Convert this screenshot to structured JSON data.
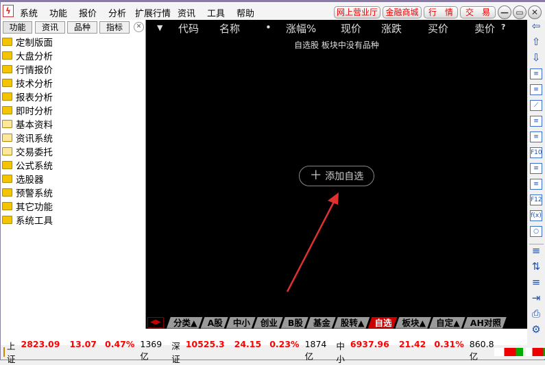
{
  "menu": {
    "items": [
      "系统",
      "功能",
      "报价",
      "分析",
      "扩展行情",
      "资讯",
      "工具",
      "帮助"
    ],
    "red_buttons": [
      "网上营业厅",
      "金融商城",
      "行　情",
      "交　易"
    ]
  },
  "left": {
    "tabs": [
      "功能",
      "资讯",
      "品种",
      "指标"
    ],
    "items": [
      {
        "label": "定制版面",
        "open": false
      },
      {
        "label": "大盘分析",
        "open": false
      },
      {
        "label": "行情报价",
        "open": false
      },
      {
        "label": "技术分析",
        "open": false
      },
      {
        "label": "报表分析",
        "open": false
      },
      {
        "label": "即时分析",
        "open": false
      },
      {
        "label": "基本资料",
        "open": true
      },
      {
        "label": "资讯系统",
        "open": true
      },
      {
        "label": "交易委托",
        "open": true
      },
      {
        "label": "公式系统",
        "open": false
      },
      {
        "label": "选股器",
        "open": false
      },
      {
        "label": "预警系统",
        "open": false
      },
      {
        "label": "其它功能",
        "open": false
      },
      {
        "label": "系统工具",
        "open": false
      }
    ]
  },
  "main": {
    "columns": [
      "代码",
      "名称",
      "•",
      "涨幅%",
      "现价",
      "涨跌",
      "买价",
      "卖价"
    ],
    "help": "?",
    "empty_message": "自选股 板块中没有品种",
    "add_button": "添加自选",
    "annotation_arrow_color": "#e03030"
  },
  "tabs": [
    {
      "label": "分类▲"
    },
    {
      "label": "A股"
    },
    {
      "label": "中小"
    },
    {
      "label": "创业"
    },
    {
      "label": "B股"
    },
    {
      "label": "基金"
    },
    {
      "label": "股转▲"
    },
    {
      "label": "自选",
      "active": true
    },
    {
      "label": "板块▲"
    },
    {
      "label": "自定▲"
    },
    {
      "label": "AH对照"
    }
  ],
  "toolbar_icons": [
    "arrow-left-icon",
    "arrow-up-icon",
    "arrow-down-icon",
    "quote-list-icon",
    "grid-icon",
    "line-chart-icon",
    "candlestick-icon",
    "windows-icon",
    "f10-icon",
    "tree-icon",
    "doc-icon",
    "f12-icon",
    "formula-icon",
    "circle-icon",
    "folder-icon",
    "sort-icon",
    "crosshair-icon",
    "import-icon",
    "printer-icon",
    "gear-icon"
  ],
  "status": {
    "indices": [
      {
        "name": "上证",
        "value": "2823.09",
        "change": "13.07",
        "pct": "0.47%",
        "volume": "1369亿"
      },
      {
        "name": "深证",
        "value": "10525.3",
        "change": "24.15",
        "pct": "0.23%",
        "volume": "1874亿"
      },
      {
        "name": "中小",
        "value": "6937.96",
        "change": "21.42",
        "pct": "0.31%",
        "volume": "860.8亿"
      }
    ]
  }
}
